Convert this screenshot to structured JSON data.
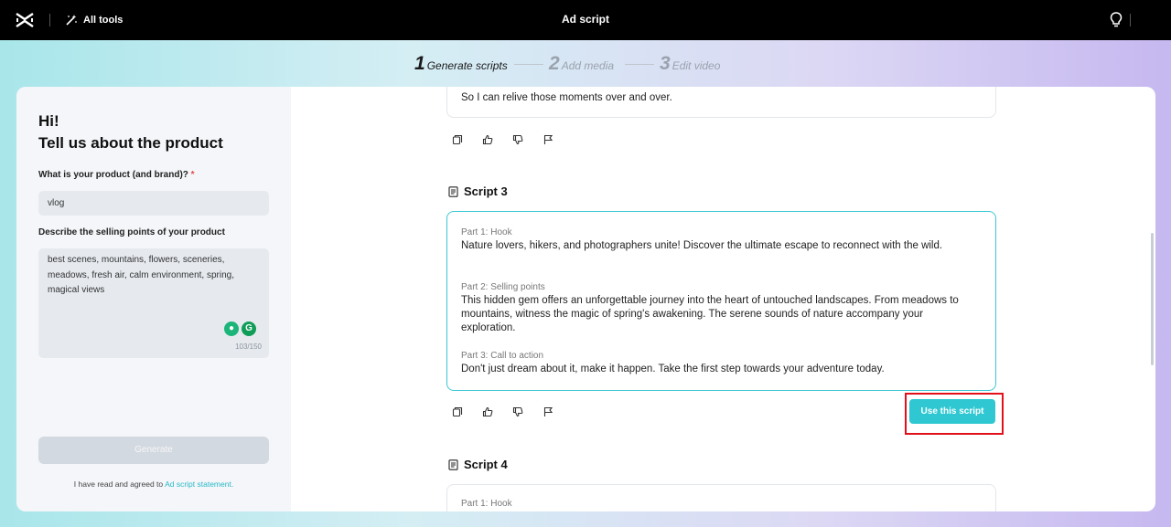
{
  "header": {
    "all_tools_label": "All tools",
    "title": "Ad script"
  },
  "stepper": {
    "steps": [
      {
        "number": "1",
        "label": "Generate scripts",
        "state": "active"
      },
      {
        "number": "2",
        "label": "Add media",
        "state": "inactive"
      },
      {
        "number": "3",
        "label": "Edit video",
        "state": "inactive"
      }
    ]
  },
  "form": {
    "greeting": "Hi!",
    "heading": "Tell us about the product",
    "product_label": "What is your product (and brand)?",
    "required_mark": "*",
    "product_value": "vlog",
    "selling_label": "Describe the selling points of your product",
    "selling_value": "best scenes, mountains, flowers, sceneries, meadows, fresh air, calm environment, spring, magical views",
    "char_count": "103/150",
    "generate_label": "Generate",
    "agreement_text": "I have read and agreed to",
    "agreement_link": "Ad script statement."
  },
  "scripts": {
    "prev_tail_text": "So I can relive those moments over and over.",
    "script3": {
      "title": "Script 3",
      "part1_label": "Part 1: Hook",
      "part1_text": "Nature lovers, hikers, and photographers unite! Discover the ultimate escape to reconnect with the wild.",
      "part2_label": "Part 2: Selling points",
      "part2_text": "This hidden gem offers an unforgettable journey into the heart of untouched landscapes. From meadows to mountains, witness the magic of spring's awakening. The serene sounds of nature accompany your exploration.",
      "part3_label": "Part 3: Call to action",
      "part3_text": "Don't just dream about it, make it happen. Take the first step towards your adventure today.",
      "use_label": "Use this script"
    },
    "script4": {
      "title": "Script 4",
      "part1_label": "Part 1: Hook"
    }
  },
  "colors": {
    "accent": "#2fc8d2",
    "highlight": "#e2101a",
    "topbar": "#000000"
  }
}
